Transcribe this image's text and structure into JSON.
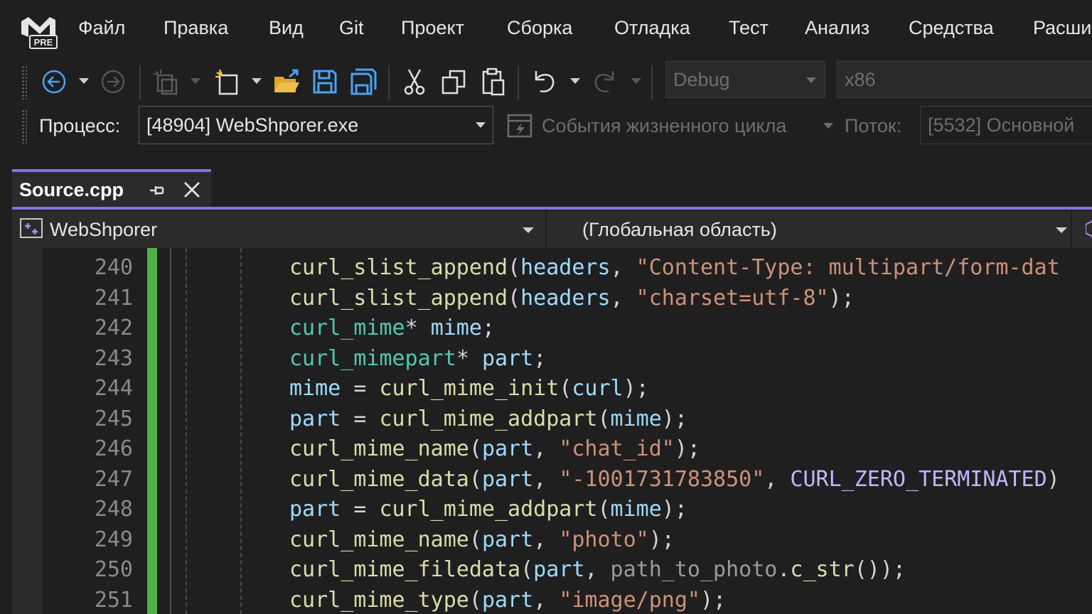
{
  "menu": {
    "items": [
      "Файл",
      "Правка",
      "Вид",
      "Git",
      "Проект",
      "Сборка",
      "Отладка",
      "Тест",
      "Анализ",
      "Средства",
      "Расши"
    ],
    "logo_text": "PRE"
  },
  "toolbar": {
    "configuration": "Debug",
    "platform": "x86"
  },
  "debug_location": {
    "process_label": "Процесс:",
    "process_value": "[48904] WebShporer.exe",
    "lifecycle_label": "События жизненного цикла",
    "thread_label": "Поток:",
    "thread_value": "[5532] Основной"
  },
  "tab": {
    "title": "Source.cpp"
  },
  "navigation": {
    "project": "WebShporer",
    "scope": "(Глобальная область)"
  },
  "editor": {
    "lines": [
      {
        "number": "240",
        "tokens": [
          [
            "fn",
            "curl_slist_append"
          ],
          [
            "punc",
            "("
          ],
          [
            "var",
            "headers"
          ],
          [
            "punc",
            ", "
          ],
          [
            "str",
            "\"Content-Type: multipart/form-dat"
          ]
        ]
      },
      {
        "number": "241",
        "tokens": [
          [
            "fn",
            "curl_slist_append"
          ],
          [
            "punc",
            "("
          ],
          [
            "var",
            "headers"
          ],
          [
            "punc",
            ", "
          ],
          [
            "str",
            "\"charset=utf-8\""
          ],
          [
            "punc",
            ");"
          ]
        ]
      },
      {
        "number": "242",
        "tokens": [
          [
            "type",
            "curl_mime"
          ],
          [
            "punc",
            "* "
          ],
          [
            "var",
            "mime"
          ],
          [
            "punc",
            ";"
          ]
        ]
      },
      {
        "number": "243",
        "tokens": [
          [
            "type",
            "curl_mimepart"
          ],
          [
            "punc",
            "* "
          ],
          [
            "var",
            "part"
          ],
          [
            "punc",
            ";"
          ]
        ]
      },
      {
        "number": "244",
        "tokens": [
          [
            "var",
            "mime"
          ],
          [
            "punc",
            " = "
          ],
          [
            "fn",
            "curl_mime_init"
          ],
          [
            "punc",
            "("
          ],
          [
            "var",
            "curl"
          ],
          [
            "punc",
            ");"
          ]
        ]
      },
      {
        "number": "245",
        "tokens": [
          [
            "var",
            "part"
          ],
          [
            "punc",
            " = "
          ],
          [
            "fn",
            "curl_mime_addpart"
          ],
          [
            "punc",
            "("
          ],
          [
            "var",
            "mime"
          ],
          [
            "punc",
            ");"
          ]
        ]
      },
      {
        "number": "246",
        "tokens": [
          [
            "fn",
            "curl_mime_name"
          ],
          [
            "punc",
            "("
          ],
          [
            "var",
            "part"
          ],
          [
            "punc",
            ", "
          ],
          [
            "str",
            "\"chat_id\""
          ],
          [
            "punc",
            ");"
          ]
        ]
      },
      {
        "number": "247",
        "tokens": [
          [
            "fn",
            "curl_mime_data"
          ],
          [
            "punc",
            "("
          ],
          [
            "var",
            "part"
          ],
          [
            "punc",
            ", "
          ],
          [
            "str",
            "\"-1001731783850\""
          ],
          [
            "punc",
            ", "
          ],
          [
            "macro",
            "CURL_ZERO_TERMINATED"
          ],
          [
            "punc",
            ")"
          ]
        ]
      },
      {
        "number": "248",
        "tokens": [
          [
            "var",
            "part"
          ],
          [
            "punc",
            " = "
          ],
          [
            "fn",
            "curl_mime_addpart"
          ],
          [
            "punc",
            "("
          ],
          [
            "var",
            "mime"
          ],
          [
            "punc",
            ");"
          ]
        ]
      },
      {
        "number": "249",
        "tokens": [
          [
            "fn",
            "curl_mime_name"
          ],
          [
            "punc",
            "("
          ],
          [
            "var",
            "part"
          ],
          [
            "punc",
            ", "
          ],
          [
            "str",
            "\"photo\""
          ],
          [
            "punc",
            ");"
          ]
        ]
      },
      {
        "number": "250",
        "tokens": [
          [
            "fn",
            "curl_mime_filedata"
          ],
          [
            "punc",
            "("
          ],
          [
            "var",
            "part"
          ],
          [
            "punc",
            ", "
          ],
          [
            "param",
            "path_to_photo"
          ],
          [
            "punc",
            "."
          ],
          [
            "mem",
            "c_str"
          ],
          [
            "punc",
            "());"
          ]
        ]
      },
      {
        "number": "251",
        "tokens": [
          [
            "fn",
            "curl_mime_type"
          ],
          [
            "punc",
            "("
          ],
          [
            "var",
            "part"
          ],
          [
            "punc",
            ", "
          ],
          [
            "str",
            "\"image/png\""
          ],
          [
            "punc",
            ");"
          ]
        ]
      }
    ]
  },
  "colors": {
    "accent": "#8a6cf0",
    "change_bar": "#4fb04a",
    "function": "#dcdcaa",
    "variable": "#9cdcfe",
    "string": "#ce9178",
    "type": "#4ec9b0",
    "macro": "#beb7ff"
  }
}
